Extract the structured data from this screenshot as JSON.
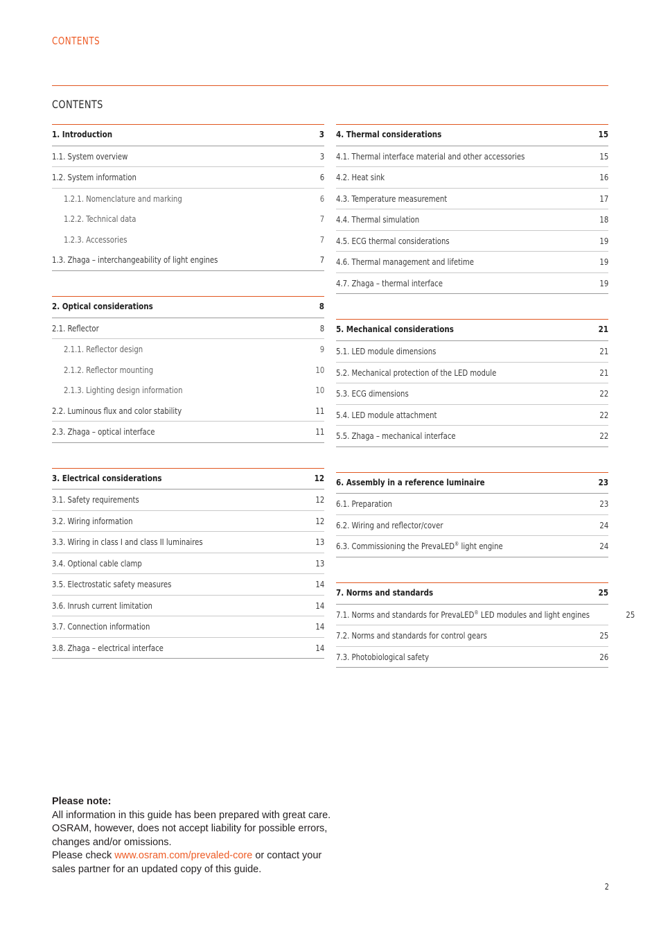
{
  "header": {
    "running_title": "CONTENTS",
    "accent_color": "#ee5b25"
  },
  "page_title": "CONTENTS",
  "page_number": "2",
  "toc": {
    "left_column": [
      {
        "rows": [
          {
            "level": 1,
            "label": "1. Introduction",
            "page": "3"
          },
          {
            "level": 2,
            "label": "1.1. System overview",
            "page": "3"
          },
          {
            "level": 2,
            "label": "1.2. System information",
            "page": "6"
          },
          {
            "level": 3,
            "label": "1.2.1. Nomenclature and marking",
            "page": "6"
          },
          {
            "level": 3,
            "label": "1.2.2. Technical data",
            "page": "7"
          },
          {
            "level": 3,
            "label": "1.2.3. Accessories",
            "page": "7"
          },
          {
            "level": 2,
            "label": "1.3. Zhaga – interchangeability of light engines",
            "page": "7"
          }
        ]
      },
      {
        "rows": [
          {
            "level": 1,
            "label": "2. Optical considerations",
            "page": "8"
          },
          {
            "level": 2,
            "label": "2.1. Reflector",
            "page": "8"
          },
          {
            "level": 3,
            "label": "2.1.1. Reflector design",
            "page": "9"
          },
          {
            "level": 3,
            "label": "2.1.2. Reflector mounting",
            "page": "10"
          },
          {
            "level": 3,
            "label": "2.1.3. Lighting design information",
            "page": "10"
          },
          {
            "level": 2,
            "label": "2.2. Luminous flux and color stability",
            "page": "11"
          },
          {
            "level": 2,
            "label": "2.3. Zhaga – optical interface",
            "page": "11"
          }
        ]
      },
      {
        "rows": [
          {
            "level": 1,
            "label": "3. Electrical considerations",
            "page": "12"
          },
          {
            "level": 2,
            "label": "3.1. Safety requirements",
            "page": "12"
          },
          {
            "level": 2,
            "label": "3.2. Wiring information",
            "page": "12"
          },
          {
            "level": 2,
            "label": "3.3. Wiring in class I and class II luminaires",
            "page": "13"
          },
          {
            "level": 2,
            "label": "3.4. Optional cable clamp",
            "page": "13"
          },
          {
            "level": 2,
            "label": "3.5. Electrostatic safety measures",
            "page": "14"
          },
          {
            "level": 2,
            "label": "3.6. Inrush current limitation",
            "page": "14"
          },
          {
            "level": 2,
            "label": "3.7. Connection information",
            "page": "14"
          },
          {
            "level": 2,
            "label": "3.8. Zhaga – electrical interface",
            "page": "14"
          }
        ]
      }
    ],
    "right_column": [
      {
        "rows": [
          {
            "level": 1,
            "label": "4. Thermal considerations",
            "page": "15"
          },
          {
            "level": 2,
            "label": "4.1. Thermal interface material and other accessories",
            "page": "15"
          },
          {
            "level": 2,
            "label": "4.2. Heat sink",
            "page": "16"
          },
          {
            "level": 2,
            "label": "4.3. Temperature measurement",
            "page": "17"
          },
          {
            "level": 2,
            "label": "4.4. Thermal simulation",
            "page": "18"
          },
          {
            "level": 2,
            "label": "4.5. ECG thermal considerations",
            "page": "19"
          },
          {
            "level": 2,
            "label": "4.6. Thermal management and lifetime",
            "page": "19"
          },
          {
            "level": 2,
            "label": "4.7. Zhaga – thermal interface",
            "page": "19"
          }
        ]
      },
      {
        "rows": [
          {
            "level": 1,
            "label": "5. Mechanical considerations",
            "page": "21"
          },
          {
            "level": 2,
            "label": "5.1. LED module dimensions",
            "page": "21"
          },
          {
            "level": 2,
            "label": "5.2. Mechanical protection of the LED module",
            "page": "21"
          },
          {
            "level": 2,
            "label": "5.3. ECG dimensions",
            "page": "22"
          },
          {
            "level": 2,
            "label": "5.4. LED module attachment",
            "page": "22"
          },
          {
            "level": 2,
            "label": "5.5. Zhaga – mechanical interface",
            "page": "22"
          }
        ]
      },
      {
        "rows": [
          {
            "level": 1,
            "label": "6. Assembly in a reference luminaire",
            "page": "23"
          },
          {
            "level": 2,
            "label": "6.1. Preparation",
            "page": "23"
          },
          {
            "level": 2,
            "label": "6.2. Wiring and reflector/cover",
            "page": "24"
          },
          {
            "level": 2,
            "label": "6.3. Commissioning the PrevaLED® light engine",
            "page": "24"
          }
        ]
      },
      {
        "rows": [
          {
            "level": 1,
            "label": "7. Norms and standards",
            "page": "25"
          },
          {
            "level": 2,
            "label": "7.1. Norms and standards for PrevaLED® LED modules and light engines",
            "page": "25"
          },
          {
            "level": 2,
            "label": "7.2. Norms and standards for control gears",
            "page": "25"
          },
          {
            "level": 2,
            "label": "7.3. Photobiological safety",
            "page": "26"
          }
        ]
      }
    ]
  },
  "note": {
    "title": "Please note:",
    "line1": "All information in this guide has been prepared with great care.",
    "line2": "OSRAM, however, does not accept liability for possible errors,",
    "line3": "changes and/or omissions.",
    "line4_before": "Please check ",
    "link": "www.osram.com/prevaled-core",
    "line4_after": " or contact your",
    "line5": "sales partner for an updated copy of this guide."
  }
}
